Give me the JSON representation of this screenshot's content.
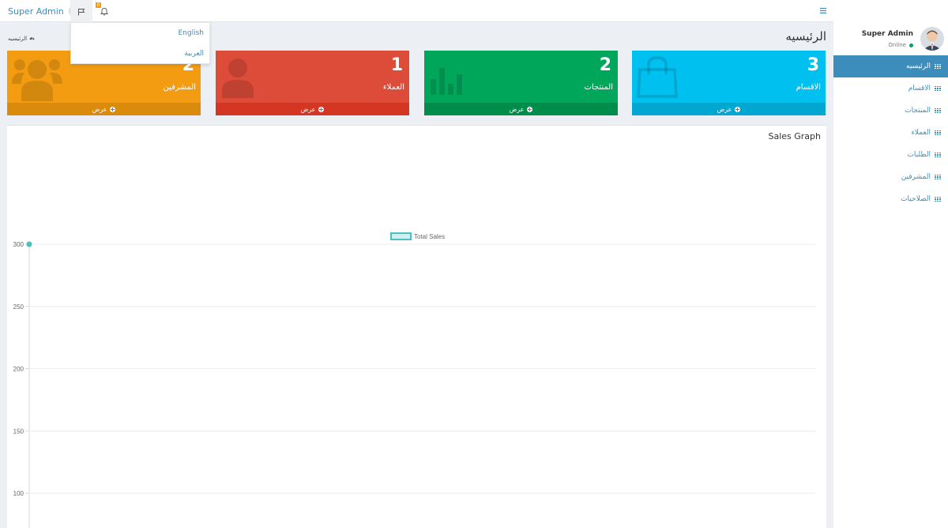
{
  "topbar": {
    "user_name": "Super Admin",
    "notification_count": "0"
  },
  "language_menu": {
    "items": [
      "English",
      "العربية"
    ]
  },
  "sidebar": {
    "user": {
      "name": "Super Admin",
      "status": "Online"
    },
    "items": [
      {
        "label": "الرئيسيه",
        "active": true
      },
      {
        "label": "الاقسام",
        "active": false
      },
      {
        "label": "المنتجات",
        "active": false
      },
      {
        "label": "العملاء",
        "active": false
      },
      {
        "label": "الطلبات",
        "active": false
      },
      {
        "label": "المشرفين",
        "active": false
      },
      {
        "label": "الصلاحيات",
        "active": false
      }
    ]
  },
  "header": {
    "title": "الرئيسيه",
    "breadcrumb": "الرئيسيه"
  },
  "boxes": [
    {
      "value": "3",
      "label": "الاقسام",
      "footer": "عرض",
      "color": "#00c0ef",
      "footer_color": "#00a7d0",
      "icon": "shopping-bag-icon"
    },
    {
      "value": "2",
      "label": "المنتجات",
      "footer": "عرض",
      "color": "#00a65a",
      "footer_color": "#008d4c",
      "icon": "bar-chart-icon"
    },
    {
      "value": "1",
      "label": "العملاء",
      "footer": "عرض",
      "color": "#dd4b39",
      "footer_color": "#d33724",
      "icon": "user-icon"
    },
    {
      "value": "2",
      "label": "المشرفين",
      "footer": "عرض",
      "color": "#f39c12",
      "footer_color": "#db8b0b",
      "icon": "users-icon"
    }
  ],
  "chart_data": {
    "type": "line",
    "title": "Sales Graph",
    "series": [
      {
        "name": "Total Sales",
        "values": [
          300
        ],
        "color": "#4bc0c0"
      }
    ],
    "y_ticks": [
      300,
      250,
      200,
      150,
      100
    ],
    "ylim": [
      100,
      300
    ],
    "grid": true,
    "legend": "top-center"
  }
}
